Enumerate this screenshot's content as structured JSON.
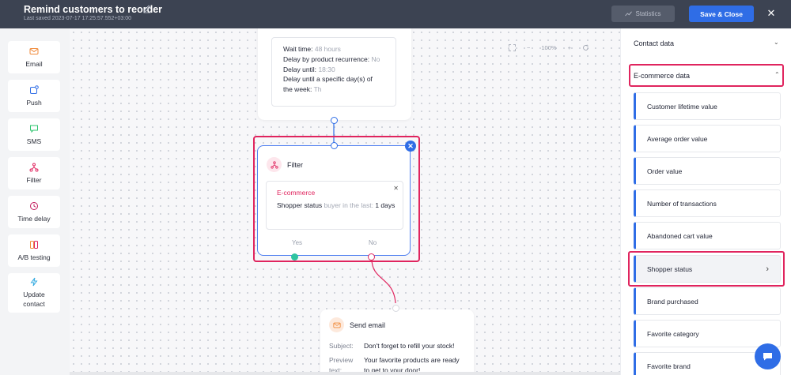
{
  "header": {
    "title": "Remind customers to reorder",
    "last_saved": "Last saved 2023-07-17 17:25:57.552+03:00",
    "statistics_label": "Statistics",
    "save_label": "Save & Close",
    "close_glyph": "✕"
  },
  "sidebar": {
    "items": [
      {
        "label": "Email",
        "icon": "mail-icon",
        "color": "#f08a3a"
      },
      {
        "label": "Push",
        "icon": "push-icon",
        "color": "#2f6de6"
      },
      {
        "label": "SMS",
        "icon": "sms-icon",
        "color": "#2ec46e"
      },
      {
        "label": "Filter",
        "icon": "filter-icon",
        "color": "#e0245e"
      },
      {
        "label": "Time delay",
        "icon": "clock-icon",
        "color": "#c2185b"
      },
      {
        "label": "A/B testing",
        "icon": "ab-icon",
        "color": "#f08a3a"
      },
      {
        "label": "Update contact",
        "icon": "bolt-icon",
        "color": "#2fa8e0"
      }
    ]
  },
  "canvas": {
    "zoom": "100%",
    "zoom_minus": "−",
    "zoom_plus": "+",
    "delay_card": {
      "wait_label": "Wait time:",
      "wait_value": "48 hours",
      "recurrence_label": "Delay by product recurrence:",
      "recurrence_value": "No",
      "until_label": "Delay until:",
      "until_value": "18:30",
      "days_label_1": "Delay until a specific day(s) of",
      "days_label_2": "the week:",
      "days_value": "Th"
    },
    "filter_card": {
      "title": "Filter",
      "condition_title": "E-commerce",
      "condition_field": "Shopper status",
      "condition_op": "buyer in the last:",
      "condition_value": "1",
      "condition_unit": "days",
      "yes_label": "Yes",
      "no_label": "No"
    },
    "email_card": {
      "title": "Send email",
      "subject_label": "Subject:",
      "subject_value": "Don't forget to refill your stock!",
      "preview_label_1": "Preview",
      "preview_label_2": "text:",
      "preview_value_1": "Your favorite products are ready",
      "preview_value_2": "to get to your door!"
    }
  },
  "right_panel": {
    "contact_data": "Contact data",
    "ecommerce_data": "E-commerce data",
    "items": [
      "Customer lifetime value",
      "Average order value",
      "Order value",
      "Number of transactions",
      "Abandoned cart value",
      "Shopper status",
      "Brand purchased",
      "Favorite category",
      "Favorite brand"
    ],
    "selected_item": "Shopper status"
  },
  "colors": {
    "accent": "#2f6de6",
    "highlight": "#e0245e",
    "topbar": "#3c4352"
  }
}
